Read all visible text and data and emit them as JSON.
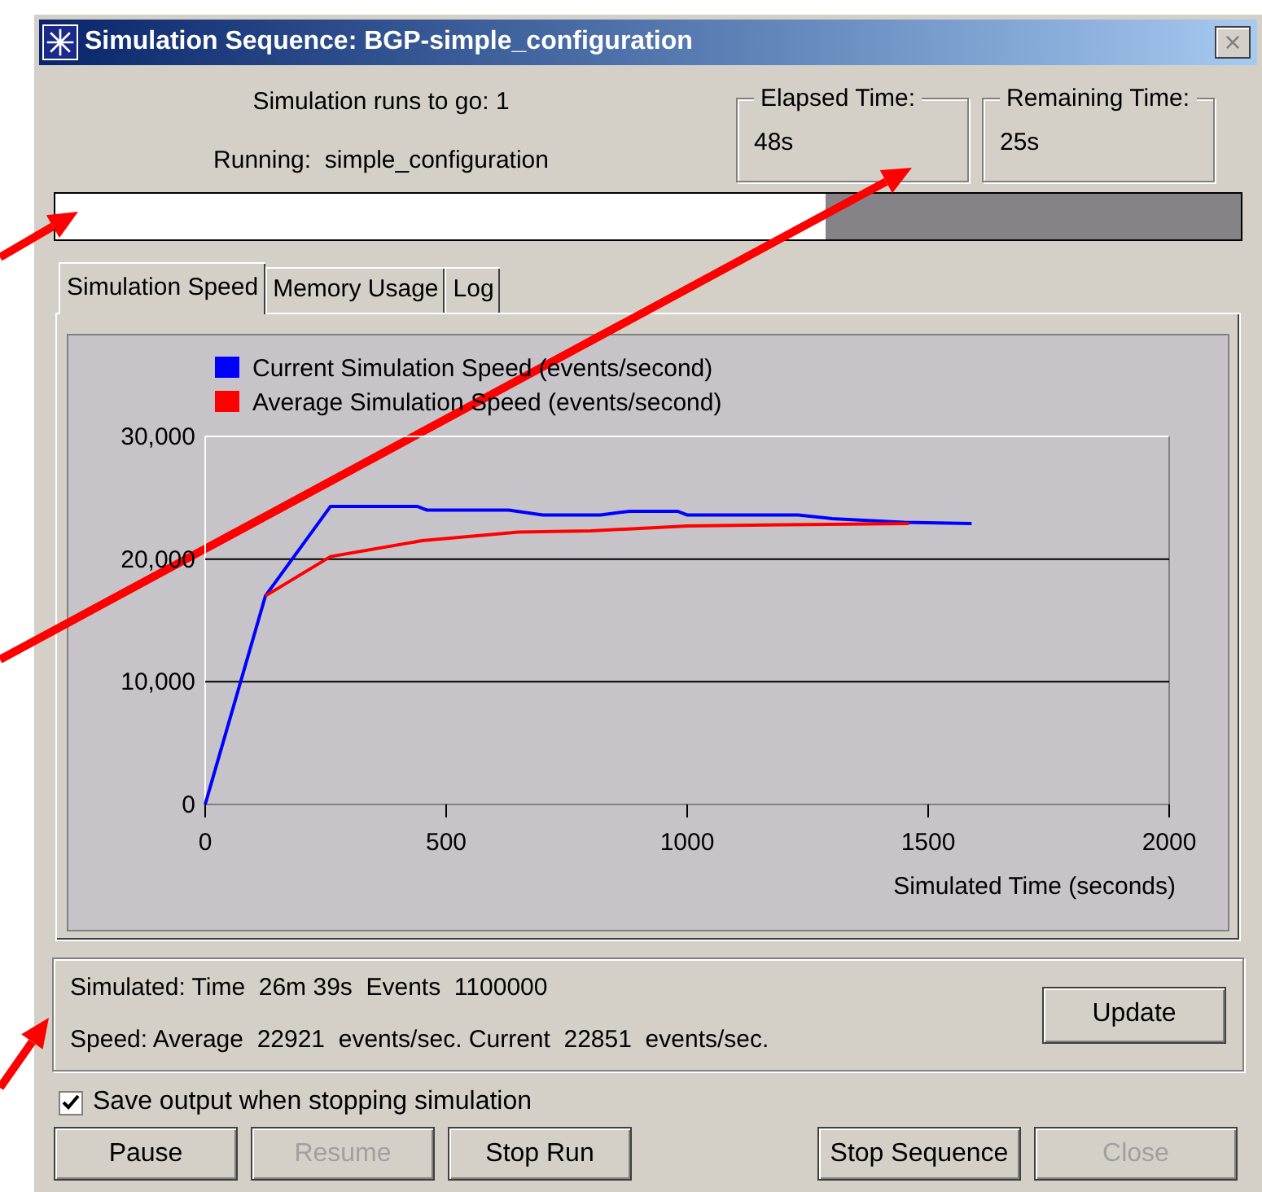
{
  "window": {
    "title": "Simulation Sequence: BGP-simple_configuration",
    "close_label": "×"
  },
  "runs_to_go": {
    "label": "Simulation runs to go:",
    "value": "1"
  },
  "running": {
    "label": "Running:",
    "value": "simple_configuration"
  },
  "elapsed": {
    "label": "Elapsed Time:",
    "value": "48s"
  },
  "remaining": {
    "label": "Remaining Time:",
    "value": "25s"
  },
  "progress": {
    "level": 0.65
  },
  "tabs": [
    {
      "label": "Simulation Speed",
      "selected": true
    },
    {
      "label": "Memory Usage",
      "selected": false
    },
    {
      "label": "Log",
      "selected": false
    }
  ],
  "chart": {
    "chart_data": {
      "type": "line",
      "legend": true,
      "xlabel": "Simulated Time (seconds)",
      "xlim": [
        0,
        2000
      ],
      "ylim": [
        0,
        30000
      ],
      "xticks": [
        0,
        500,
        1000,
        1500,
        2000
      ],
      "yticks": [
        {
          "value": 0,
          "label": "0"
        },
        {
          "value": 10000,
          "label": "10,000"
        },
        {
          "value": 20000,
          "label": "20,000"
        },
        {
          "value": 30000,
          "label": "30,000"
        }
      ],
      "series": [
        {
          "name": "Current Simulation Speed (events/second)",
          "color": "#0000ff",
          "x": [
            0,
            125,
            260,
            440,
            460,
            630,
            700,
            820,
            880,
            980,
            1000,
            1230,
            1300,
            1450,
            1590
          ],
          "values": [
            0,
            17000,
            24300,
            24300,
            24000,
            24000,
            23600,
            23600,
            23900,
            23900,
            23600,
            23600,
            23300,
            23000,
            22900
          ]
        },
        {
          "name": "Average Simulation Speed (events/second)",
          "color": "#ff0000",
          "x": [
            125,
            260,
            450,
            650,
            800,
            1000,
            1200,
            1460
          ],
          "values": [
            17000,
            20200,
            21500,
            22200,
            22300,
            22700,
            22800,
            22900
          ]
        }
      ]
    }
  },
  "status": {
    "line_1": "Simulated: Time  26m 39s  Events  1100000",
    "line_2": "Speed: Average  22921  events/sec. Current  22851  events/sec.",
    "update_button": "Update"
  },
  "save_output": {
    "label": "Save output when stopping simulation",
    "checked": true
  },
  "buttons_left": [
    {
      "label": "Pause",
      "disabled": false
    },
    {
      "label": "Resume",
      "disabled": true
    },
    {
      "label": "Stop Run",
      "disabled": false
    }
  ],
  "buttons_right": [
    {
      "label": "Stop Sequence",
      "disabled": false
    },
    {
      "label": "Close",
      "disabled": true
    }
  ]
}
